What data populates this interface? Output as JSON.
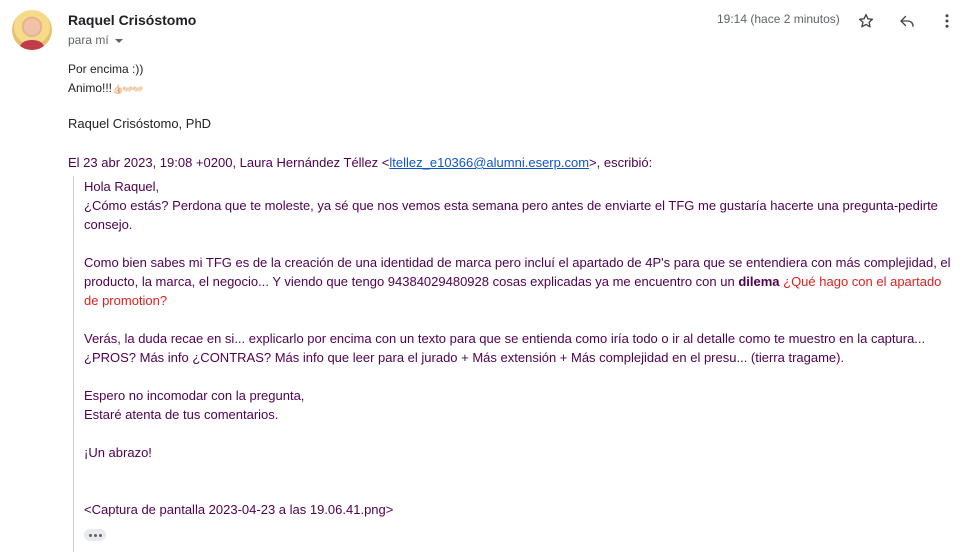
{
  "header": {
    "sender": "Raquel Crisóstomo",
    "to_label": "para mí",
    "time": "19:14 (hace 2 minutos)"
  },
  "icons": {
    "star": "star-icon",
    "reply": "reply-icon",
    "more": "more-vert-icon"
  },
  "body": {
    "line1": "Por encima :))",
    "line2": "Animo!!!",
    "emoji": "👍🏻👐🏻👐🏻",
    "signature": "Raquel Crisóstomo, PhD"
  },
  "attribution": {
    "prefix": "El 23 abr 2023, 19:08 +0200, Laura Hernández Téllez <",
    "email": "ltellez_e10366@alumni.eserp.com",
    "suffix": ">, escribió:"
  },
  "quote": {
    "p1": "Hola Raquel,",
    "p2a": "¿Cómo estás? Perdona que te moleste, ya sé que nos vemos esta semana pero antes de enviarte el TFG me gustaría hacerte una pregunta-pedirte",
    "p2b": "consejo.",
    "p3a": "Como bien sabes mi TFG es de la creación de una identidad de marca pero incluí el apartado de 4P's para que se entendiera con más complejidad, el",
    "p3b": "producto, la marca, el negocio... Y viendo que tengo 94384029480928 cosas explicadas ya me encuentro con un ",
    "p3b_bold": "dilema",
    "p3b_red": "¿Qué hago con el apartado",
    "p3c_red": "de promotion?",
    "p4a": "Verás, la duda recae en si... explicarlo por encima con un texto para que se entienda como iría todo o ir al detalle como te muestro en la captura...",
    "p4b": "¿PROS? Más info ¿CONTRAS? Más info que leer para el jurado + Más extensión + Más complejidad en el presu... (tierra tragame).",
    "p5a": "Espero no incomodar con la pregunta,",
    "p5b": "Estaré atenta de tus comentarios.",
    "p6": "¡Un abrazo!",
    "attachment": "<Captura de pantalla 2023-04-23 a las 19.06.41.png>"
  },
  "colors": {
    "quote_text": "#500050",
    "link": "#1155cc",
    "highlight": "#e02020",
    "secondary": "#5f6368"
  }
}
